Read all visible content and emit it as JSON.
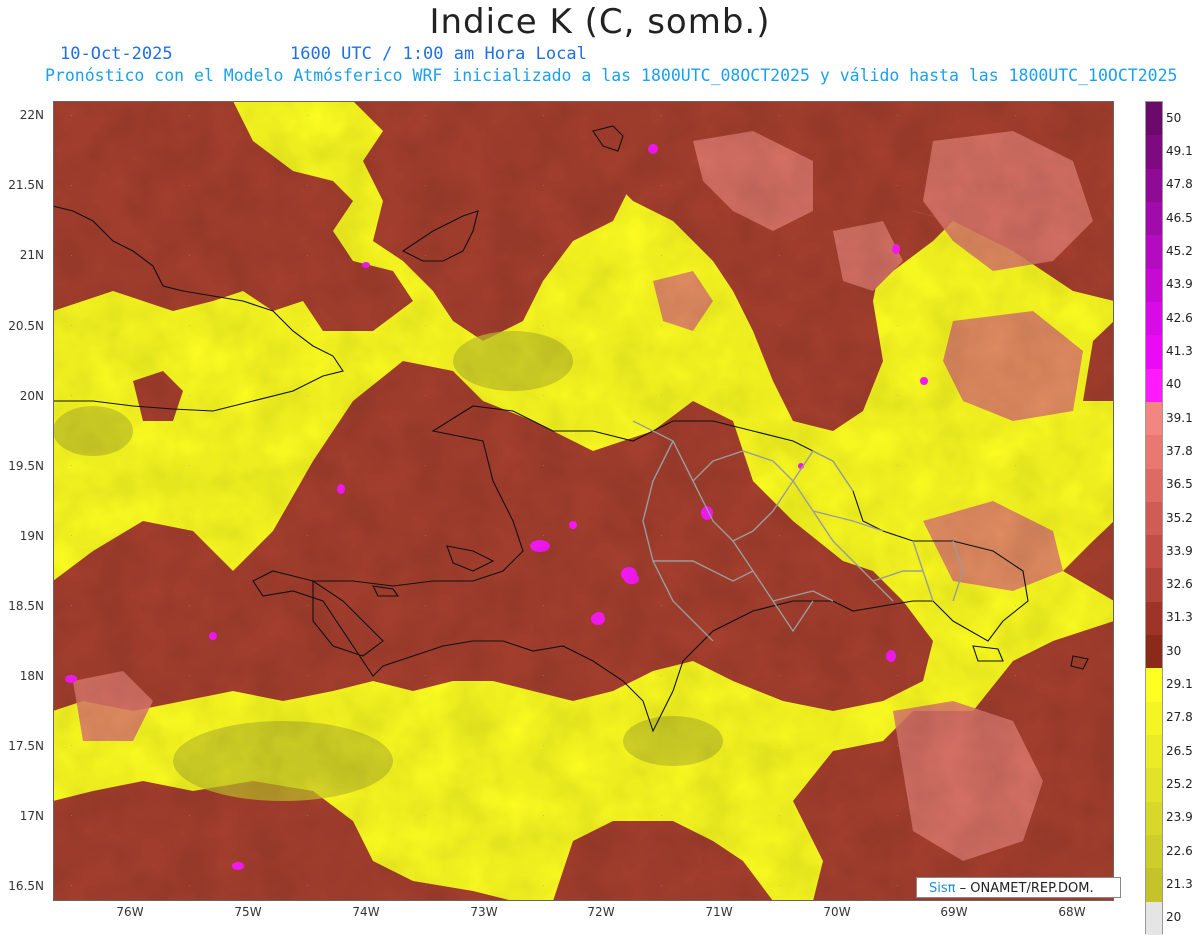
{
  "title": "Indice K (C, somb.)",
  "header": {
    "date": "10-Oct-2025",
    "time": "1600 UTC / 1:00 am Hora Local",
    "info": "Pronóstico con el Modelo Atmósferico WRF inicializado a las 1800UTC_08OCT2025 y válido hasta las  1800UTC_10OCT2025"
  },
  "lat_labels": [
    "22N",
    "21.5N",
    "21N",
    "20.5N",
    "20N",
    "19.5N",
    "19N",
    "18.5N",
    "18N",
    "17.5N",
    "17N",
    "16.5N"
  ],
  "lon_labels": [
    "76W",
    "75W",
    "74W",
    "73W",
    "72W",
    "71W",
    "70W",
    "69W",
    "68W"
  ],
  "colorbar": {
    "levels": [
      "50",
      "49.1",
      "47.8",
      "46.5",
      "45.2",
      "43.9",
      "42.6",
      "41.3",
      "40",
      "39.1",
      "37.8",
      "36.5",
      "35.2",
      "33.9",
      "32.6",
      "31.3",
      "30",
      "29.1",
      "27.8",
      "26.5",
      "25.2",
      "23.9",
      "22.6",
      "21.3",
      "20"
    ],
    "colors": [
      "#6b0a6b",
      "#7d0a80",
      "#8f0a95",
      "#a10aab",
      "#b40ac0",
      "#c60ad4",
      "#d80ae8",
      "#ea0af5",
      "#ff1aff",
      "#f2877f",
      "#e87870",
      "#dd6b63",
      "#cf5d55",
      "#c14f47",
      "#b2433a",
      "#9e3427",
      "#8c2a1a",
      "#ffff22",
      "#f5f524",
      "#ecec26",
      "#e2e228",
      "#d8d82a",
      "#cece2a",
      "#c4c42a",
      "#e5e5e5"
    ]
  },
  "credit": {
    "brand": "Sisπ",
    "text": " – ONAMET/REP.DOM."
  }
}
